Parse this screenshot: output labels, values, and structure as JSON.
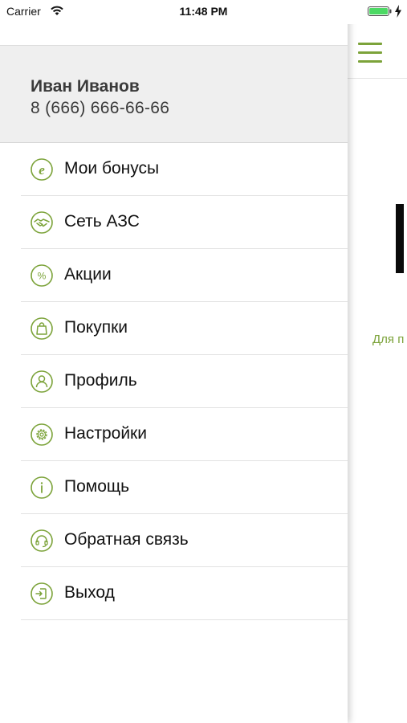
{
  "status_bar": {
    "carrier": "Carrier",
    "time": "11:48 PM",
    "battery_level": 1.0
  },
  "colors": {
    "accent": "#7ca33a",
    "profile_bg": "#efefef",
    "text": "#111111"
  },
  "profile": {
    "name": "Иван Иванов",
    "phone": "8 (666) 666-66-66"
  },
  "menu": {
    "items": [
      {
        "label": "Мои бонусы",
        "icon": "bonus-e-icon"
      },
      {
        "label": "Сеть АЗС",
        "icon": "handshake-icon"
      },
      {
        "label": "Акции",
        "icon": "percent-icon"
      },
      {
        "label": "Покупки",
        "icon": "shopping-bag-icon"
      },
      {
        "label": "Профиль",
        "icon": "person-icon"
      },
      {
        "label": "Настройки",
        "icon": "gear-icon"
      },
      {
        "label": "Помощь",
        "icon": "info-icon"
      },
      {
        "label": "Обратная связь",
        "icon": "headset-icon"
      },
      {
        "label": "Выход",
        "icon": "logout-icon"
      }
    ]
  },
  "background_app": {
    "hint_text": "Для п"
  }
}
